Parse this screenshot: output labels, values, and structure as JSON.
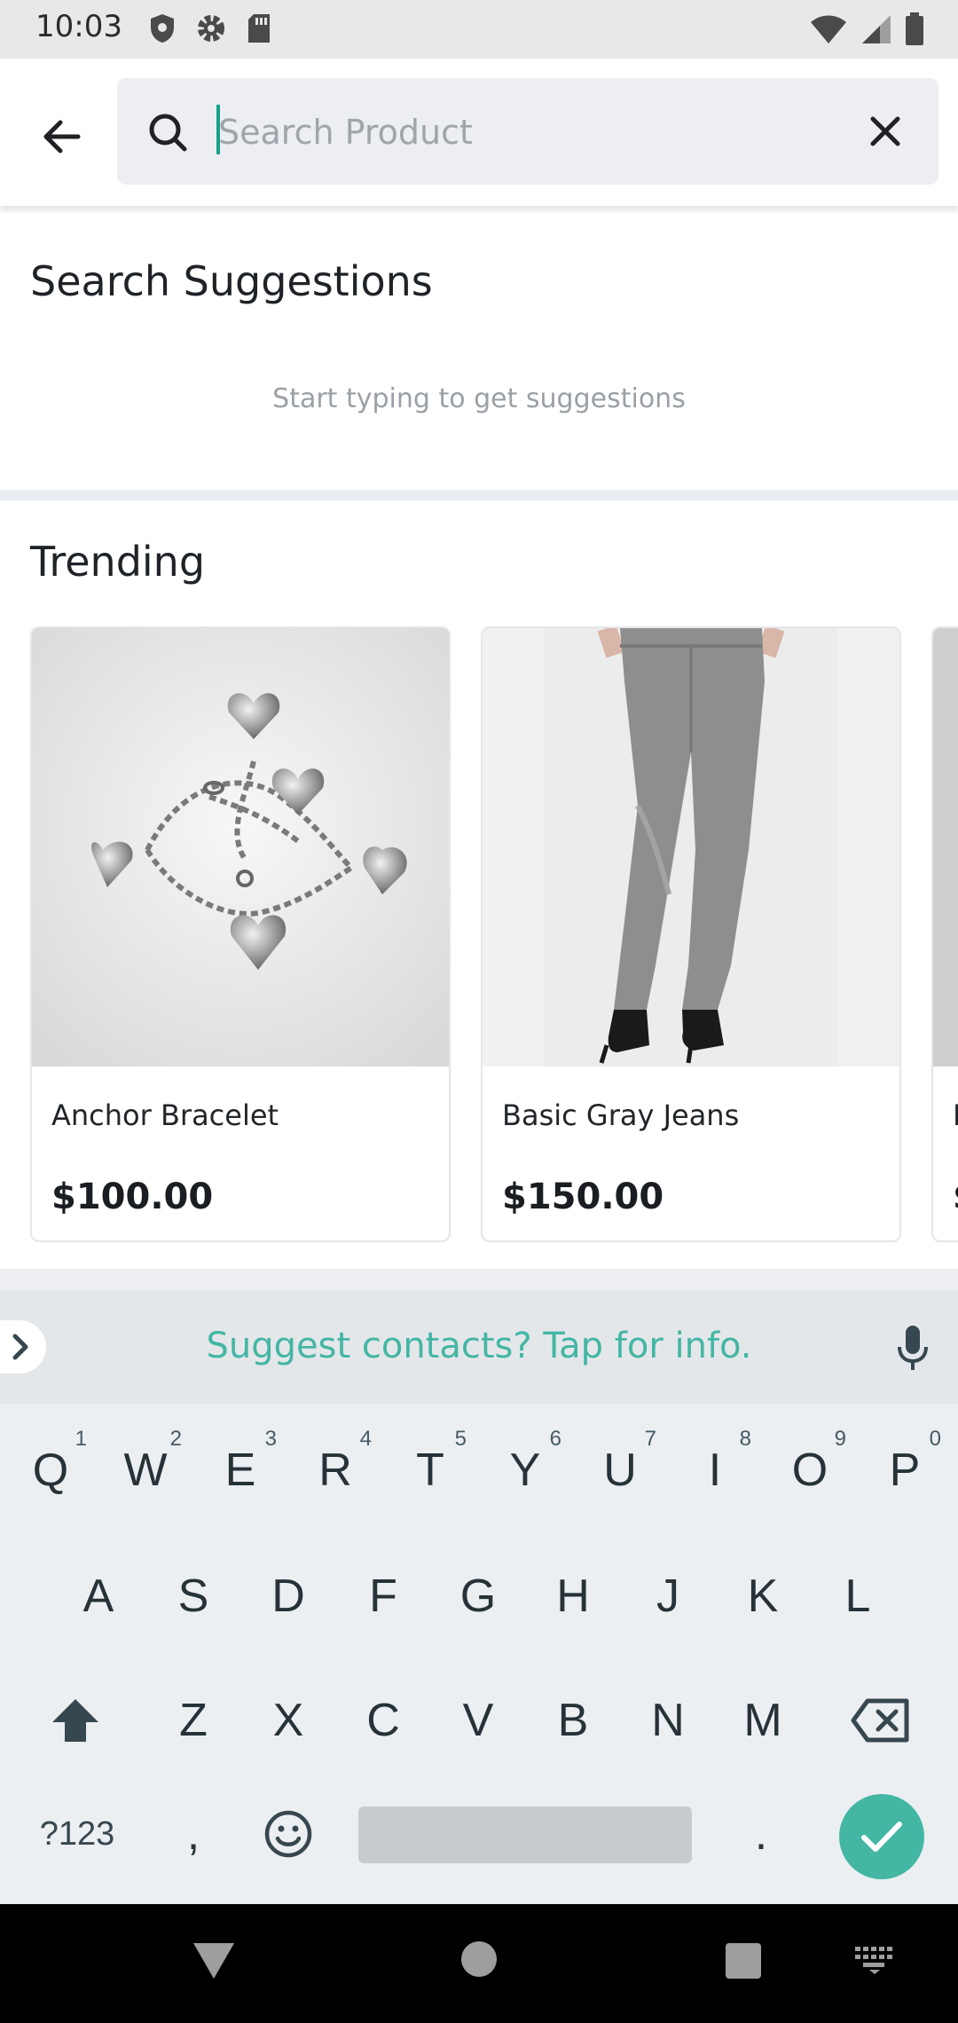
{
  "status_bar": {
    "time": "10:03",
    "left_icons": [
      "shield-icon",
      "gear-icon",
      "sd-card-icon"
    ],
    "right_icons": [
      "wifi-icon",
      "cellular-signal-icon",
      "battery-icon"
    ]
  },
  "search": {
    "placeholder": "Search Product",
    "value": "",
    "icons": {
      "back": "arrow-left-icon",
      "search": "search-icon",
      "clear": "close-icon"
    }
  },
  "suggestions": {
    "title": "Search Suggestions",
    "hint": "Start typing to get suggestions"
  },
  "trending": {
    "title": "Trending",
    "products": [
      {
        "name": "Anchor Bracelet",
        "price": "$100.00"
      },
      {
        "name": "Basic Gray Jeans",
        "price": "$150.00"
      },
      {
        "name": "B",
        "price": "$"
      }
    ]
  },
  "keyboard": {
    "suggest_text": "Suggest contacts? Tap for info.",
    "row1": [
      {
        "key": "Q",
        "num": "1"
      },
      {
        "key": "W",
        "num": "2"
      },
      {
        "key": "E",
        "num": "3"
      },
      {
        "key": "R",
        "num": "4"
      },
      {
        "key": "T",
        "num": "5"
      },
      {
        "key": "Y",
        "num": "6"
      },
      {
        "key": "U",
        "num": "7"
      },
      {
        "key": "I",
        "num": "8"
      },
      {
        "key": "O",
        "num": "9"
      },
      {
        "key": "P",
        "num": "0"
      }
    ],
    "row2": [
      "A",
      "S",
      "D",
      "F",
      "G",
      "H",
      "J",
      "K",
      "L"
    ],
    "row3": [
      "Z",
      "X",
      "C",
      "V",
      "B",
      "N",
      "M"
    ],
    "symbols_label": "?123",
    "comma": ",",
    "period": ".",
    "accent_color": "#43b6a4"
  },
  "nav_bar": {
    "icons": [
      "nav-back-icon",
      "nav-home-icon",
      "nav-recents-icon",
      "keyboard-switch-icon"
    ]
  }
}
